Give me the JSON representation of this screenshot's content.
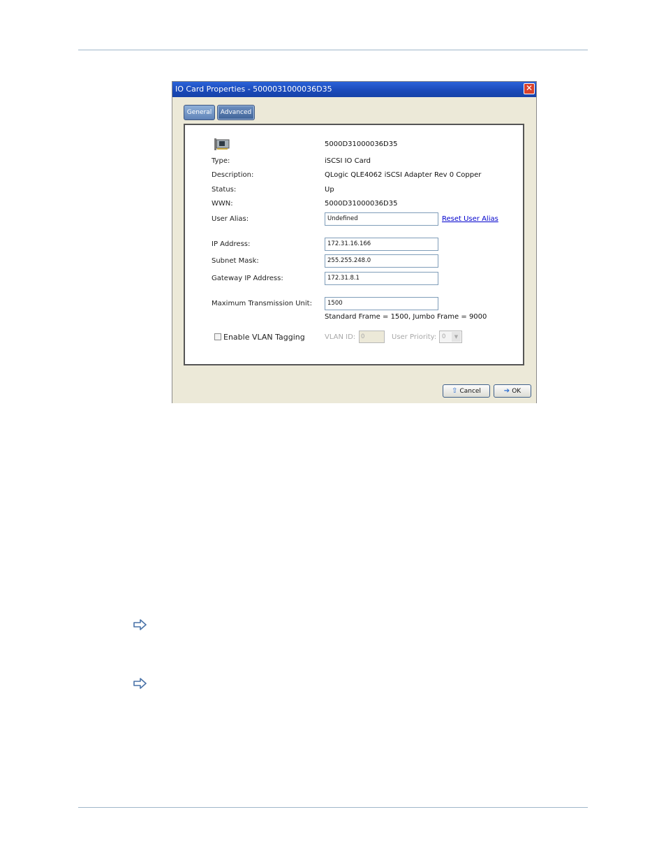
{
  "dialog": {
    "title": "IO Card Properties - 5000031000036D35",
    "close": "✕",
    "tabs": {
      "general": "General",
      "advanced": "Advanced"
    },
    "header_value": "5000D31000036D35",
    "type_label": "Type:",
    "type_value": "iSCSI IO Card",
    "description_label": "Description:",
    "description_value": "QLogic QLE4062 iSCSI Adapter Rev 0 Copper",
    "status_label": "Status:",
    "status_value": "Up",
    "wwn_label": "WWN:",
    "wwn_value": "5000D31000036D35",
    "alias_label": "User Alias:",
    "alias_value": "Undefined",
    "reset_alias": "Reset User Alias",
    "ip_label": "IP Address:",
    "ip_value": "172.31.16.166",
    "subnet_label": "Subnet Mask:",
    "subnet_value": "255.255.248.0",
    "gateway_label": "Gateway IP Address:",
    "gateway_value": "172.31.8.1",
    "mtu_label": "Maximum Transmission Unit:",
    "mtu_value": "1500",
    "mtu_note": "Standard Frame = 1500, Jumbo Frame = 9000",
    "vlan_enable_label": "Enable VLAN Tagging",
    "vlan_id_label": "VLAN ID:",
    "vlan_id_value": "0",
    "priority_label": "User Priority:",
    "priority_value": "0",
    "cancel": "Cancel",
    "ok": "OK"
  },
  "icons": [
    "io-card-icon",
    "close-icon",
    "up-arrow-icon",
    "right-arrow-icon",
    "note-arrow-icon"
  ]
}
